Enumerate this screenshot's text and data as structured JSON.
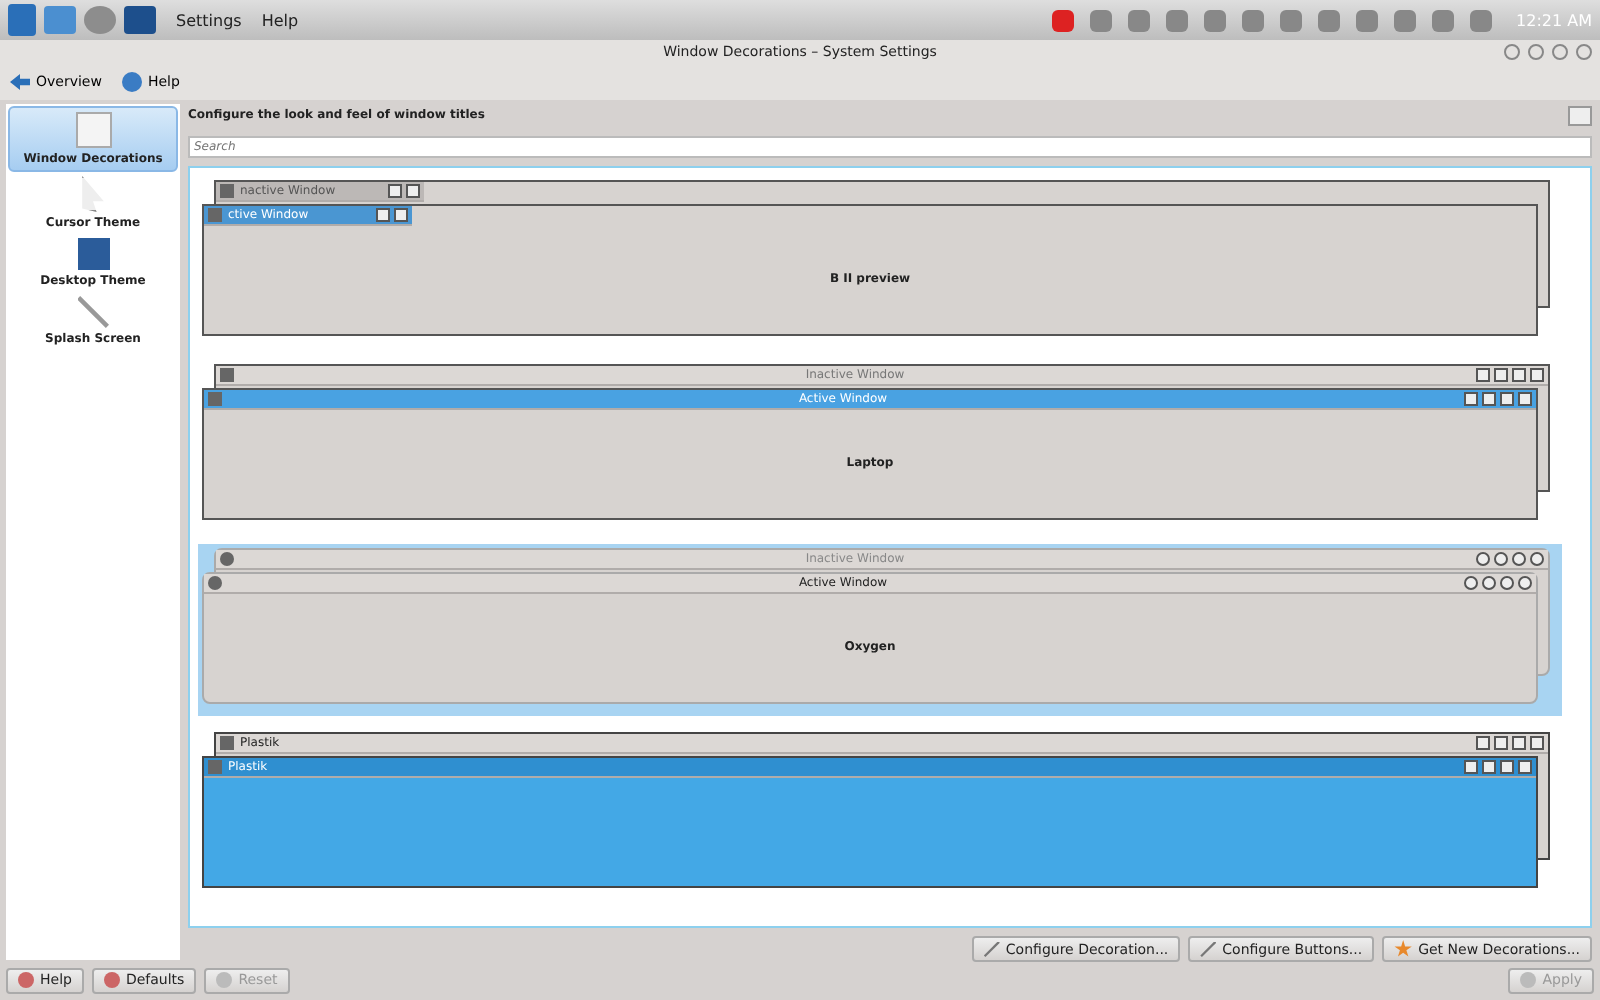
{
  "panel": {
    "menu": [
      "Settings",
      "Help"
    ],
    "clock": "12:21 AM"
  },
  "window": {
    "title": "Window Decorations – System Settings"
  },
  "toolbar": [
    {
      "label": "Overview"
    },
    {
      "label": "Help"
    }
  ],
  "sidebar": {
    "items": [
      {
        "label": "Window Decorations",
        "selected": true
      },
      {
        "label": "Cursor Theme",
        "selected": false
      },
      {
        "label": "Desktop Theme",
        "selected": false
      },
      {
        "label": "Splash Screen",
        "selected": false
      }
    ]
  },
  "header": "Configure the look and feel of window titles",
  "search": {
    "placeholder": "Search"
  },
  "decorations": [
    {
      "kind": "b2",
      "inactive_title": "nactive Window",
      "active_title": "ctive Window",
      "preview_label": "B II preview",
      "selected": false
    },
    {
      "kind": "laptop",
      "inactive_title": "Inactive Window",
      "active_title": "Active Window",
      "preview_label": "Laptop",
      "selected": false
    },
    {
      "kind": "oxygen",
      "inactive_title": "Inactive Window",
      "active_title": "Active Window",
      "preview_label": "Oxygen",
      "selected": true
    },
    {
      "kind": "plastik",
      "inactive_title": "Plastik",
      "active_title": "Plastik",
      "selected": false
    }
  ],
  "actions": [
    "Configure Decoration...",
    "Configure Buttons...",
    "Get New Decorations..."
  ],
  "footer": [
    {
      "label": "Help",
      "disabled": false
    },
    {
      "label": "Defaults",
      "disabled": false
    },
    {
      "label": "Reset",
      "disabled": true
    },
    {
      "label": "Apply",
      "disabled": true
    }
  ]
}
